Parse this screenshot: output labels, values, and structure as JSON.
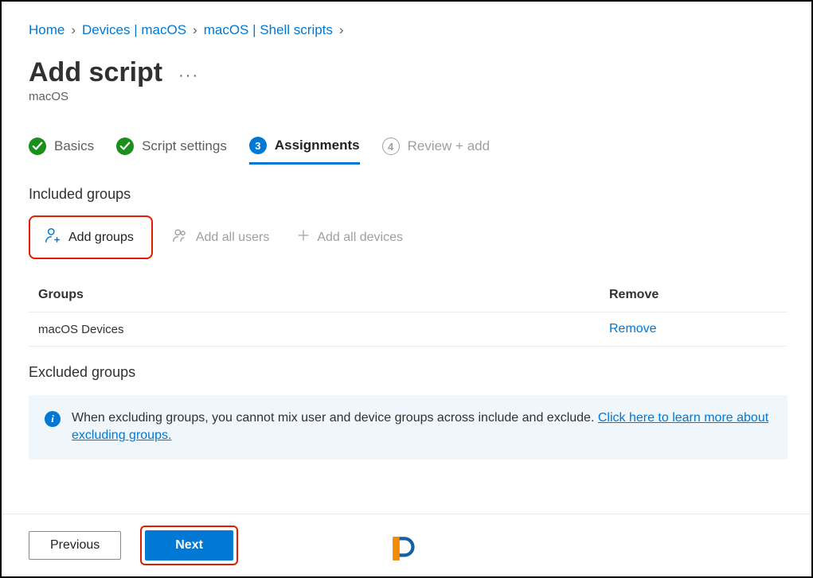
{
  "breadcrumb": {
    "home": "Home",
    "devices": "Devices | macOS",
    "scripts": "macOS | Shell scripts"
  },
  "page": {
    "title": "Add script",
    "subtitle": "macOS"
  },
  "steps": {
    "s1": {
      "label": "Basics"
    },
    "s2": {
      "label": "Script settings"
    },
    "s3": {
      "num": "3",
      "label": "Assignments"
    },
    "s4": {
      "num": "4",
      "label": "Review + add"
    }
  },
  "included": {
    "title": "Included groups",
    "add_groups": "Add groups",
    "add_all_users": "Add all users",
    "add_all_devices": "Add all devices",
    "col_groups": "Groups",
    "col_remove": "Remove",
    "row1_name": "macOS Devices",
    "row1_remove": "Remove"
  },
  "excluded": {
    "title": "Excluded groups",
    "info_text": "When excluding groups, you cannot mix user and device groups across include and exclude. ",
    "info_link": "Click here to learn more about excluding groups."
  },
  "footer": {
    "previous": "Previous",
    "next": "Next"
  }
}
